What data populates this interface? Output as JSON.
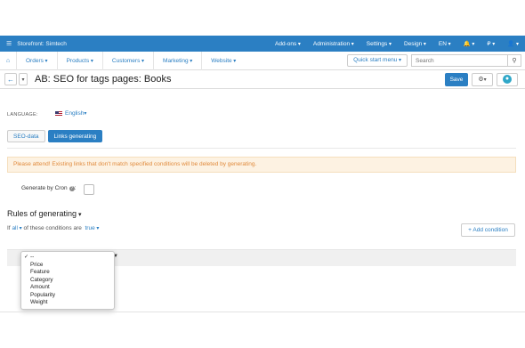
{
  "topbar": {
    "store": "Storefront: Simtech",
    "items": [
      "Add-ons",
      "Administration",
      "Settings",
      "Design",
      "EN",
      "",
      "₽",
      ""
    ]
  },
  "navbar": {
    "items": [
      "Orders",
      "Products",
      "Customers",
      "Marketing",
      "Website"
    ],
    "quick_start": "Quick start menu",
    "search_placeholder": "Search"
  },
  "title": {
    "text": "AB: SEO for tags pages: Books",
    "save": "Save"
  },
  "language": {
    "label": "LANGUAGE:",
    "value": "English"
  },
  "tabs": [
    "SEO-data",
    "Links generating"
  ],
  "alert": "Please attend! Existing links that don't match specified conditions will be deleted by generating.",
  "cron": {
    "label": "Generate by Cron"
  },
  "rules": {
    "title": "Rules of generating",
    "if": "If",
    "all": "all",
    "of_conditions": "of these conditions are",
    "true": "true",
    "add_condition": "+ Add condition"
  },
  "dropdown": {
    "options": [
      "--",
      "Price",
      "Feature",
      "Category",
      "Amount",
      "Popularity",
      "Weight"
    ],
    "selected": "--"
  },
  "colors": {
    "accent": "#2b7fc3",
    "alert_bg": "#fdf2e2",
    "alert_text": "#e08a3c"
  }
}
